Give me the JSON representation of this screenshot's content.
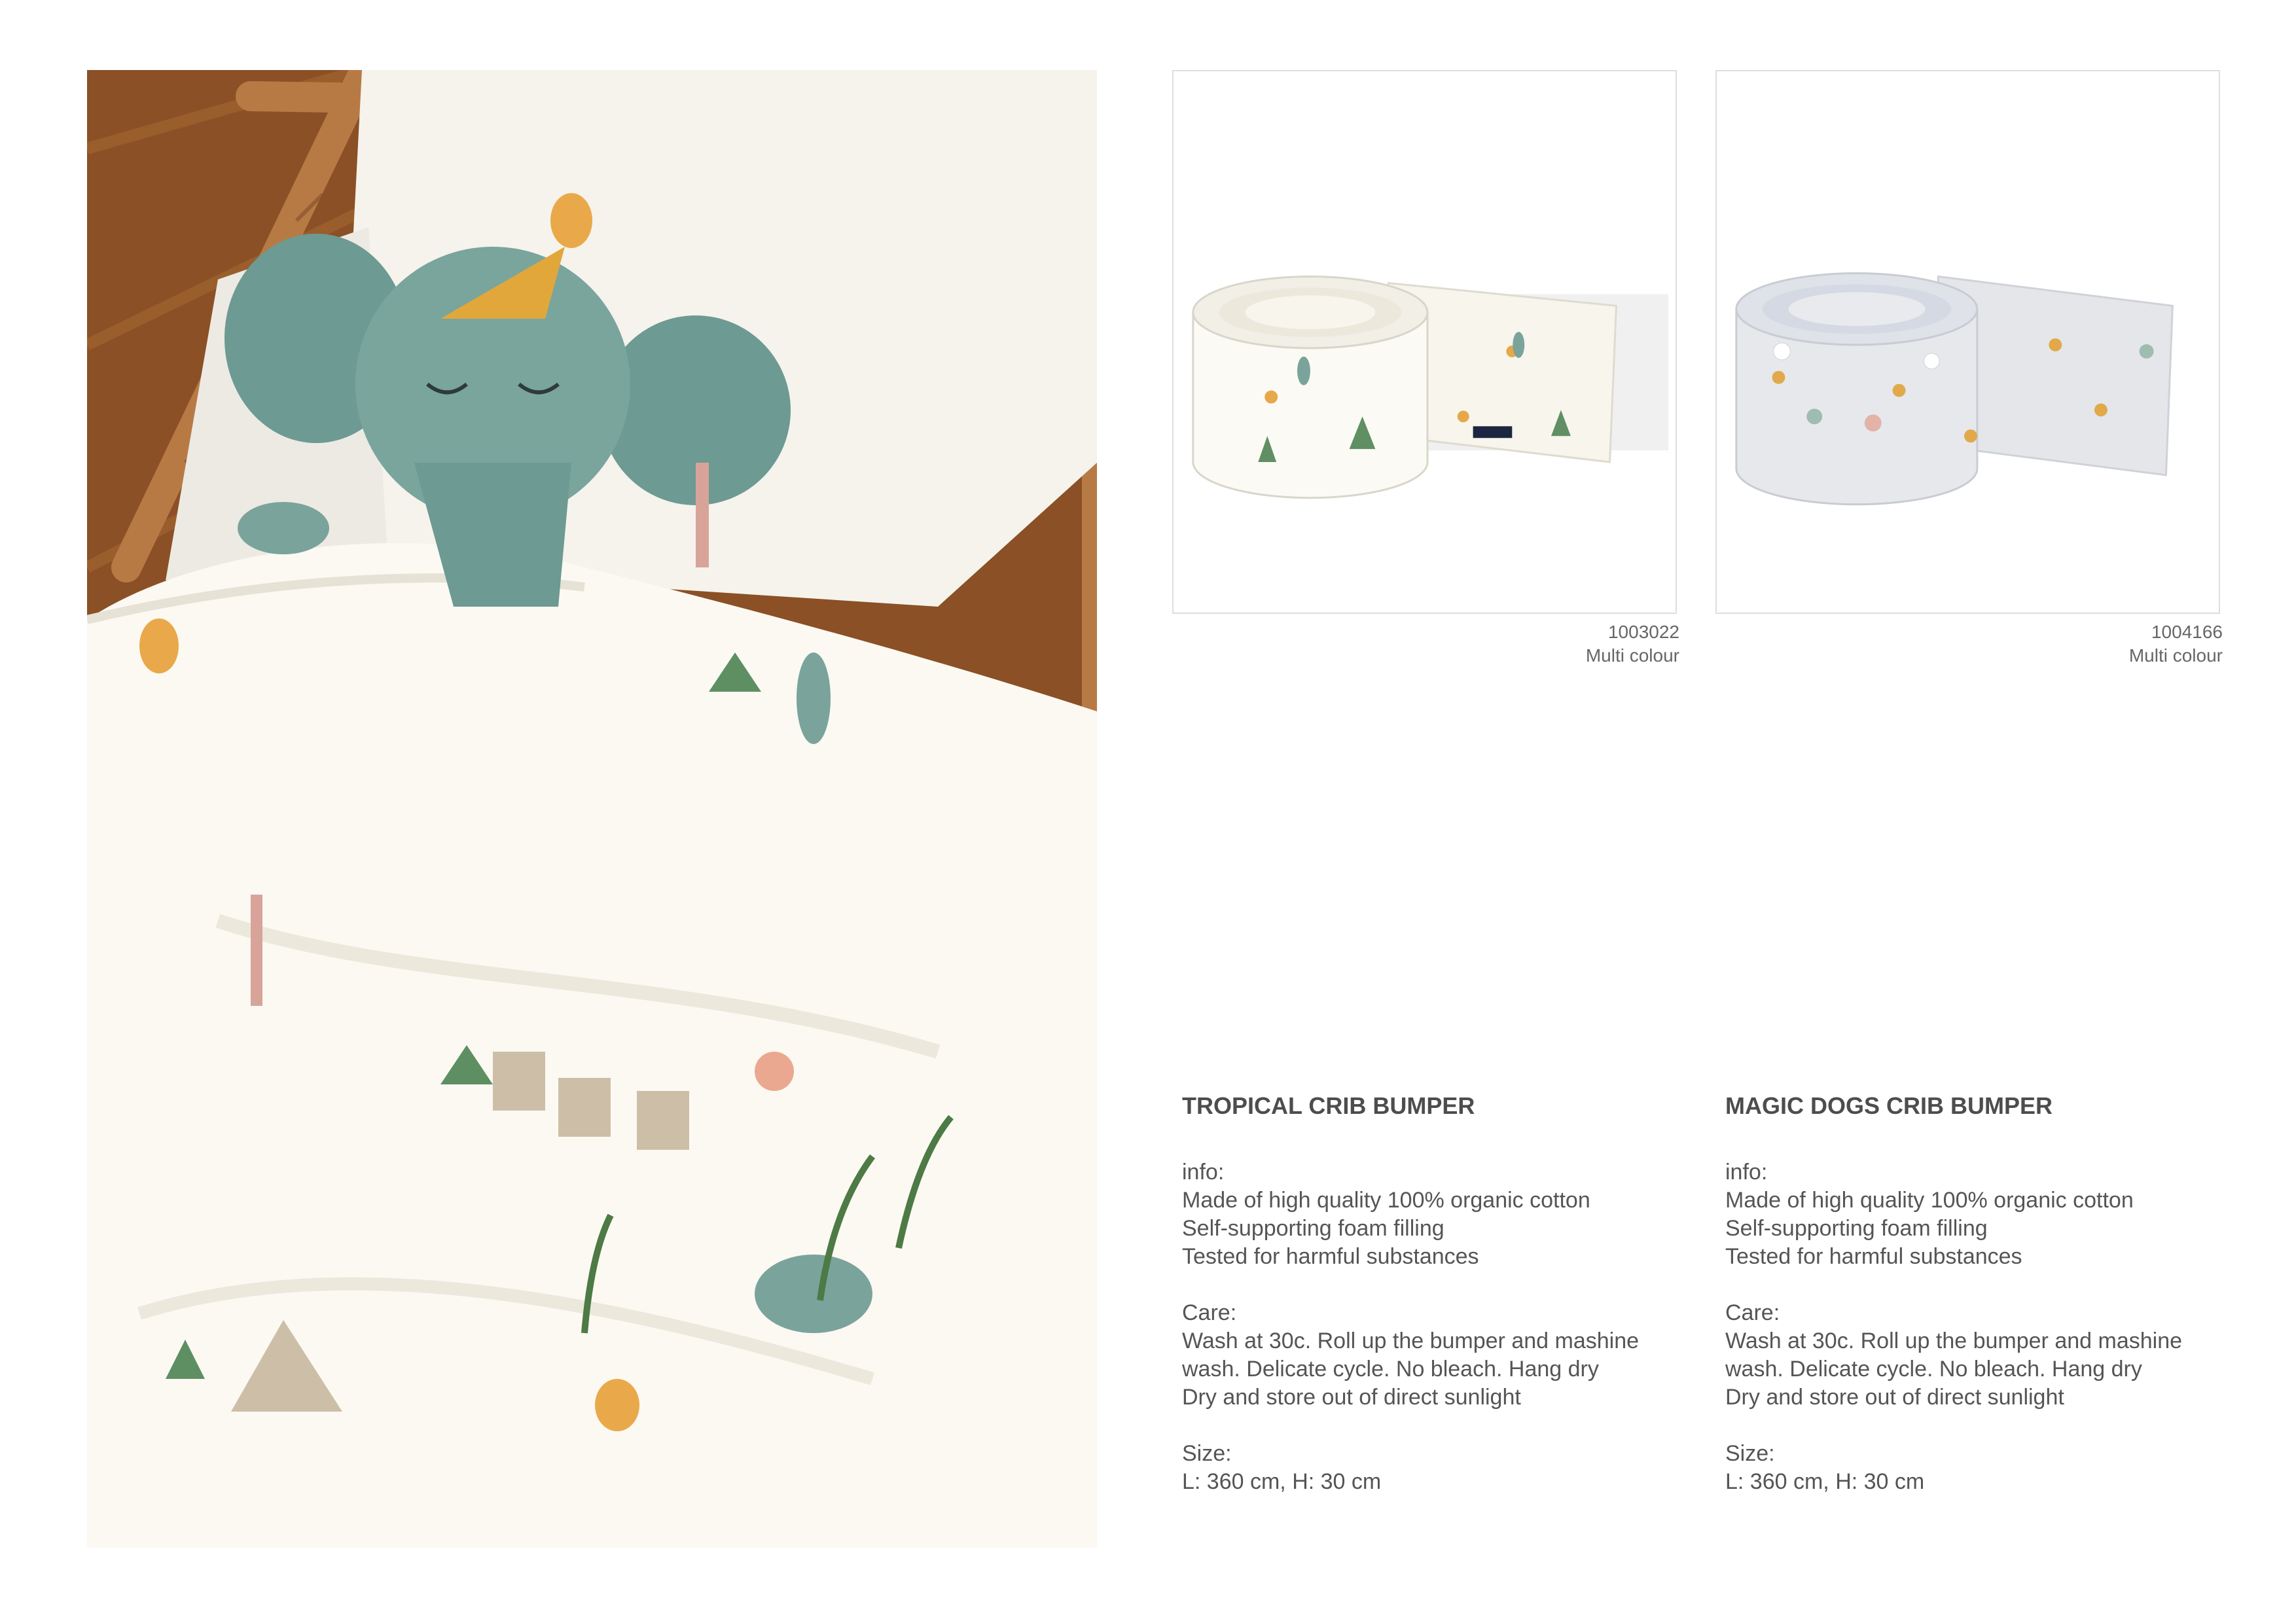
{
  "hero": {
    "icon": "crib-bedding-photo"
  },
  "products": [
    {
      "image_icon": "tropical-bumper-image",
      "sku": "1003022",
      "colour": "Multi colour",
      "title": "TROPICAL CRIB BUMPER",
      "info_heading": "info:",
      "info_lines": [
        "Made of high quality 100% organic cotton",
        "Self-supporting foam filling",
        "Tested for harmful substances"
      ],
      "care_heading": "Care:",
      "care_lines": [
        "Wash at 30c. Roll up the bumper and mashine",
        "wash. Delicate cycle. No bleach. Hang dry",
        "Dry and store out of direct sunlight"
      ],
      "size_heading": "Size:",
      "size_value": "L: 360 cm, H: 30 cm"
    },
    {
      "image_icon": "magic-dogs-bumper-image",
      "sku": "1004166",
      "colour": "Multi colour",
      "title": "MAGIC DOGS CRIB BUMPER",
      "info_heading": "info:",
      "info_lines": [
        "Made of high quality 100% organic cotton",
        "Self-supporting foam filling",
        "Tested for harmful substances"
      ],
      "care_heading": "Care:",
      "care_lines": [
        "Wash at 30c. Roll up the bumper and mashine",
        "wash. Delicate cycle. No bleach. Hang dry",
        "Dry and store out of direct sunlight"
      ],
      "size_heading": "Size:",
      "size_value": "L: 360 cm, H: 30 cm"
    }
  ]
}
